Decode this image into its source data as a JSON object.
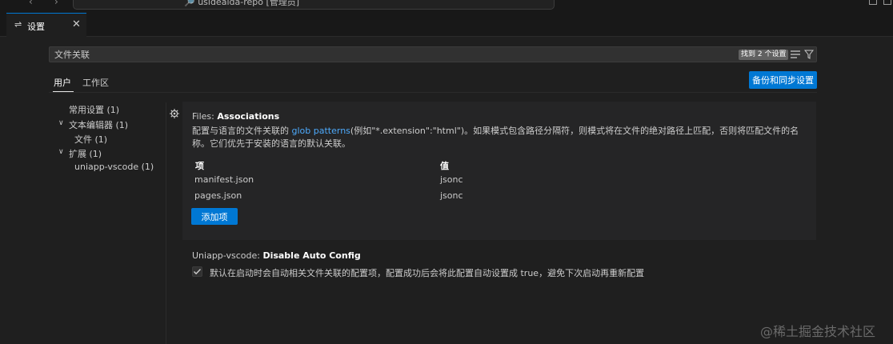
{
  "titlebar": {
    "back_icon": "arrow-left-icon",
    "forward_icon": "arrow-right-icon",
    "command_center_text": "🔎 usideaida-repo [管理员]"
  },
  "tab": {
    "icon": "settings-sliders-icon",
    "label": "设置",
    "close": "✕"
  },
  "search": {
    "value": "文件关联",
    "result_badge": "找到 2 个设置",
    "clear_icon": "clear-filter-icon",
    "filter_icon": "filter-icon"
  },
  "scopes": {
    "user": "用户",
    "workspace": "工作区"
  },
  "sync_button": "备份和同步设置",
  "toc": {
    "common": "常用设置 (1)",
    "text_editor": "文本编辑器 (1)",
    "files": "文件 (1)",
    "extensions": "扩展 (1)",
    "uniapp": "uniapp-vscode (1)"
  },
  "setting1": {
    "category": "Files: ",
    "name": "Associations",
    "desc_before": "配置与语言的文件关联的 ",
    "desc_link": "glob patterns",
    "desc_after": "(例如\"*.extension\":\"html\")。如果模式包含路径分隔符，则模式将在文件的绝对路径上匹配，否则将匹配文件的名称。它们优先于安装的语言的默认关联。",
    "col_key": "项",
    "col_value": "值",
    "rows": [
      {
        "key": "manifest.json",
        "value": "jsonc"
      },
      {
        "key": "pages.json",
        "value": "jsonc"
      }
    ],
    "add_button": "添加项"
  },
  "setting2": {
    "category": "Uniapp-vscode: ",
    "name": "Disable Auto Config",
    "checked": true,
    "description": "默认在启动时会自动相关文件关联的配置项，配置成功后会将此配置自动设置成 true，避免下次启动再重新配置"
  },
  "watermark": "@稀土掘金技术社区",
  "colors": {
    "accent": "#0078d4",
    "link": "#4daafc",
    "background": "#1f1f1f"
  }
}
